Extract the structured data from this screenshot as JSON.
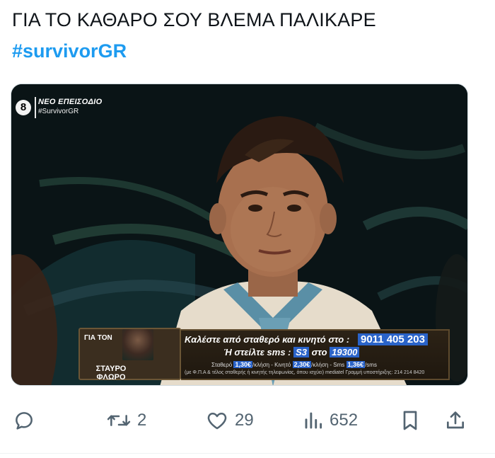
{
  "tweet": {
    "text": "ΓΙΑ ΤΟ ΚΑΘΑΡΟ ΣΟΥ ΒΛΕΜΑ ΠΑΛΙΚΑΡΕ",
    "hashtag": "#survivorGR"
  },
  "media": {
    "channel_logo": "8",
    "episode_label": "ΝΕΟ ΕΠΕΙΣΟΔΙΟ",
    "channel_hashtag": "#SurvivorGR",
    "lower_third": {
      "for_label": "ΓΙΑ ΤΟΝ",
      "name_line1": "ΣΤΑΥΡΟ",
      "name_line2": "ΦΛΩΡΟ",
      "call_text": "Καλέστε από σταθερό και κινητό στο :",
      "phone_number": "9011 405 203",
      "sms_prefix": "Ή στείλτε sms :",
      "sms_code": "S3",
      "sms_to": "στο",
      "sms_number": "19300",
      "cost_fixed_label": "Σταθερό",
      "cost_fixed": "1,30€",
      "cost_fixed_unit": "/κλήση - Κινητό",
      "cost_mobile": "2,30€",
      "cost_mobile_unit": "/κλήση - Sms",
      "cost_sms": "1,36€",
      "cost_sms_unit": "/sms",
      "legal": "(με Φ.Π.Α & τέλος σταθερής ή κινητής τηλεφωνίας, όπου ισχύει) mediatel Γραμμή υποστήριξης: 214 214 8420"
    }
  },
  "actions": {
    "replies_icon": "reply-icon",
    "retweets_icon": "retweet-icon",
    "retweets": "2",
    "likes_icon": "heart-icon",
    "likes": "29",
    "views_icon": "views-icon",
    "views": "652",
    "bookmark_icon": "bookmark-icon",
    "share_icon": "share-icon"
  },
  "colors": {
    "hashtag": "#1d9bf0",
    "action_icon": "#536471",
    "lower_third_highlight": "#2a63c9"
  }
}
